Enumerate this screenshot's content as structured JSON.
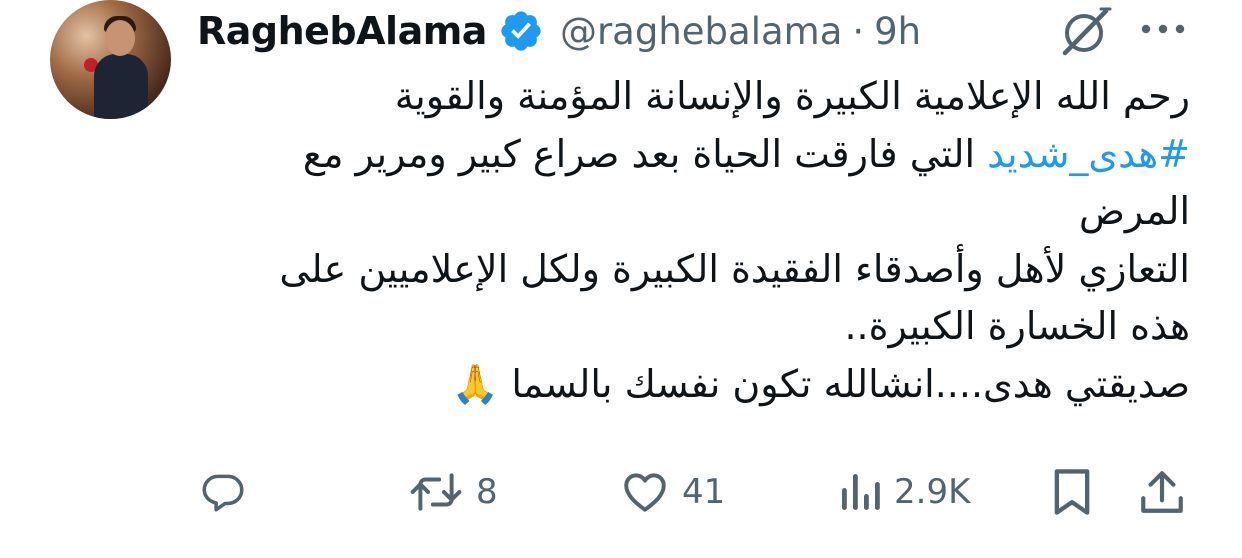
{
  "author": {
    "display_name": "RaghebAlama",
    "handle": "@raghebalama",
    "separator": "·",
    "time": "9h",
    "verified": true,
    "verified_color": "#1d9bf0"
  },
  "header_icons": {
    "grok": "grok-icon",
    "more": "more-options-icon"
  },
  "body": {
    "line1": "رحم الله الإعلامية الكبيرة والإنسانة المؤمنة والقوية",
    "line2_hashtag": "#هدى_شديد",
    "line2_text": " التي فارقت الحياة بعد صراع كبير ومرير مع",
    "line3": "المرض",
    "line4": "التعازي لأهل وأصدقاء الفقيدة الكبيرة ولكل الإعلاميين على",
    "line5": "هذه الخسارة الكبيرة..",
    "line6": "صديقتي هدى....انشالله تكون نفسك بالسما ",
    "line6_emoji": "🙏",
    "hashtag_color": "#1d9bf0"
  },
  "actions": {
    "reply_icon": "reply-icon",
    "retweets": "8",
    "likes": "41",
    "views": "2.9K",
    "bookmark_icon": "bookmark-icon",
    "share_icon": "share-icon"
  }
}
